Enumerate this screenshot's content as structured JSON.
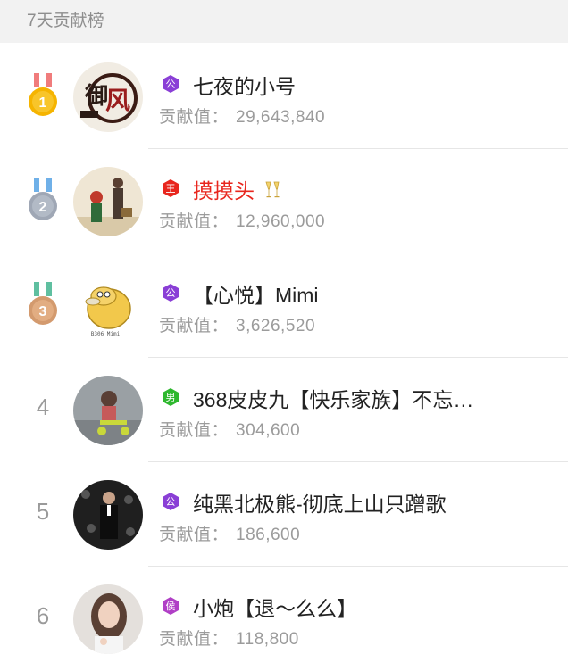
{
  "header": {
    "title": "7天贡献榜"
  },
  "contribution_label": "贡献值：",
  "rows": [
    {
      "rank": "1",
      "name": "七夜的小号",
      "badge": "公",
      "badge_color": "#8a3fd6",
      "value": "29,643,840",
      "name_color": "#222222",
      "avatar": "avatar-logo"
    },
    {
      "rank": "2",
      "name": "摸摸头",
      "badge": "王",
      "badge_color": "#e8261e",
      "value": "12,960,000",
      "name_color": "#e8261e",
      "avatar": "avatar-photo"
    },
    {
      "rank": "3",
      "name": "【心悦】Mimi",
      "badge": "公",
      "badge_color": "#8a3fd6",
      "value": "3,626,520",
      "name_color": "#222222",
      "avatar": "avatar-duck"
    },
    {
      "rank": "4",
      "name": "368皮皮九【快乐家族】不忘…",
      "badge": "男",
      "badge_color": "#2eb82e",
      "value": "304,600",
      "name_color": "#222222",
      "avatar": "avatar-photo"
    },
    {
      "rank": "5",
      "name": "纯黑北极熊-彻底上山只蹭歌",
      "badge": "公",
      "badge_color": "#8a3fd6",
      "value": "186,600",
      "name_color": "#222222",
      "avatar": "avatar-photo"
    },
    {
      "rank": "6",
      "name": "小炮【退～么么】",
      "badge": "侯",
      "badge_color": "#b03fc6",
      "value": "118,800",
      "name_color": "#222222",
      "avatar": "avatar-photo"
    }
  ],
  "colors": {
    "medal_gold": "#f5b400",
    "medal_silver": "#9fa7b5",
    "medal_bronze": "#d39a6e"
  }
}
